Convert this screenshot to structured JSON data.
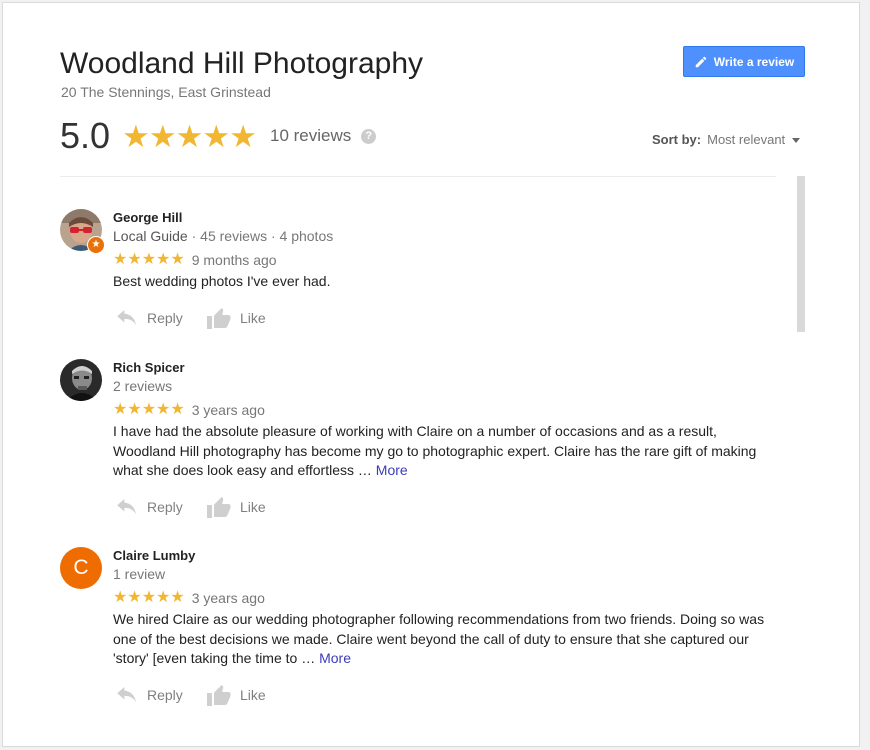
{
  "place": {
    "title": "Woodland Hill Photography",
    "address": "20 The Stennings, East Grinstead"
  },
  "write_review": {
    "label": "Write a review"
  },
  "summary": {
    "rating": "5.0",
    "stars": "★★★★★",
    "review_count": "10 reviews",
    "help_glyph": "?",
    "star_color": "#f2b732"
  },
  "sort": {
    "label": "Sort by:",
    "value": "Most relevant"
  },
  "reviews": [
    {
      "name": "George Hill",
      "meta_guide": "Local Guide",
      "meta_rest": " · 45 reviews · 4 photos",
      "stars": "★★★★★",
      "rating": 5,
      "when": "9 months ago",
      "text": "Best wedding photos I've ever had.",
      "more": "",
      "avatar": "photo",
      "reply": "Reply",
      "like": "Like"
    },
    {
      "name": "Rich Spicer",
      "meta_guide": "",
      "meta_rest": "2 reviews",
      "stars": "★★★★★",
      "rating": 5,
      "when": "3 years ago",
      "text": "I have had the absolute pleasure of working with Claire on a number of occasions and as a result, Woodland Hill photography has become my go to photographic expert. Claire has the rare gift of making what she does look easy and effortless … ",
      "more": "More",
      "avatar": "photo",
      "reply": "Reply",
      "like": "Like"
    },
    {
      "name": "Claire Lumby",
      "meta_guide": "",
      "meta_rest": "1 review",
      "stars": "★★★★★",
      "rating": 5,
      "when": "3 years ago",
      "text": "We hired Claire as our wedding photographer following recommendations from two friends. Doing so was one of the best decisions we made. Claire went beyond the call of duty to ensure that she captured our 'story' [even taking the time to … ",
      "more": "More",
      "avatar_letter": "C",
      "avatar_color": "#ef6c00",
      "reply": "Reply",
      "like": "Like"
    }
  ],
  "colors": {
    "button": "#4d90fe",
    "link": "#3c3cb8",
    "guide_badge": "#e8710a"
  }
}
